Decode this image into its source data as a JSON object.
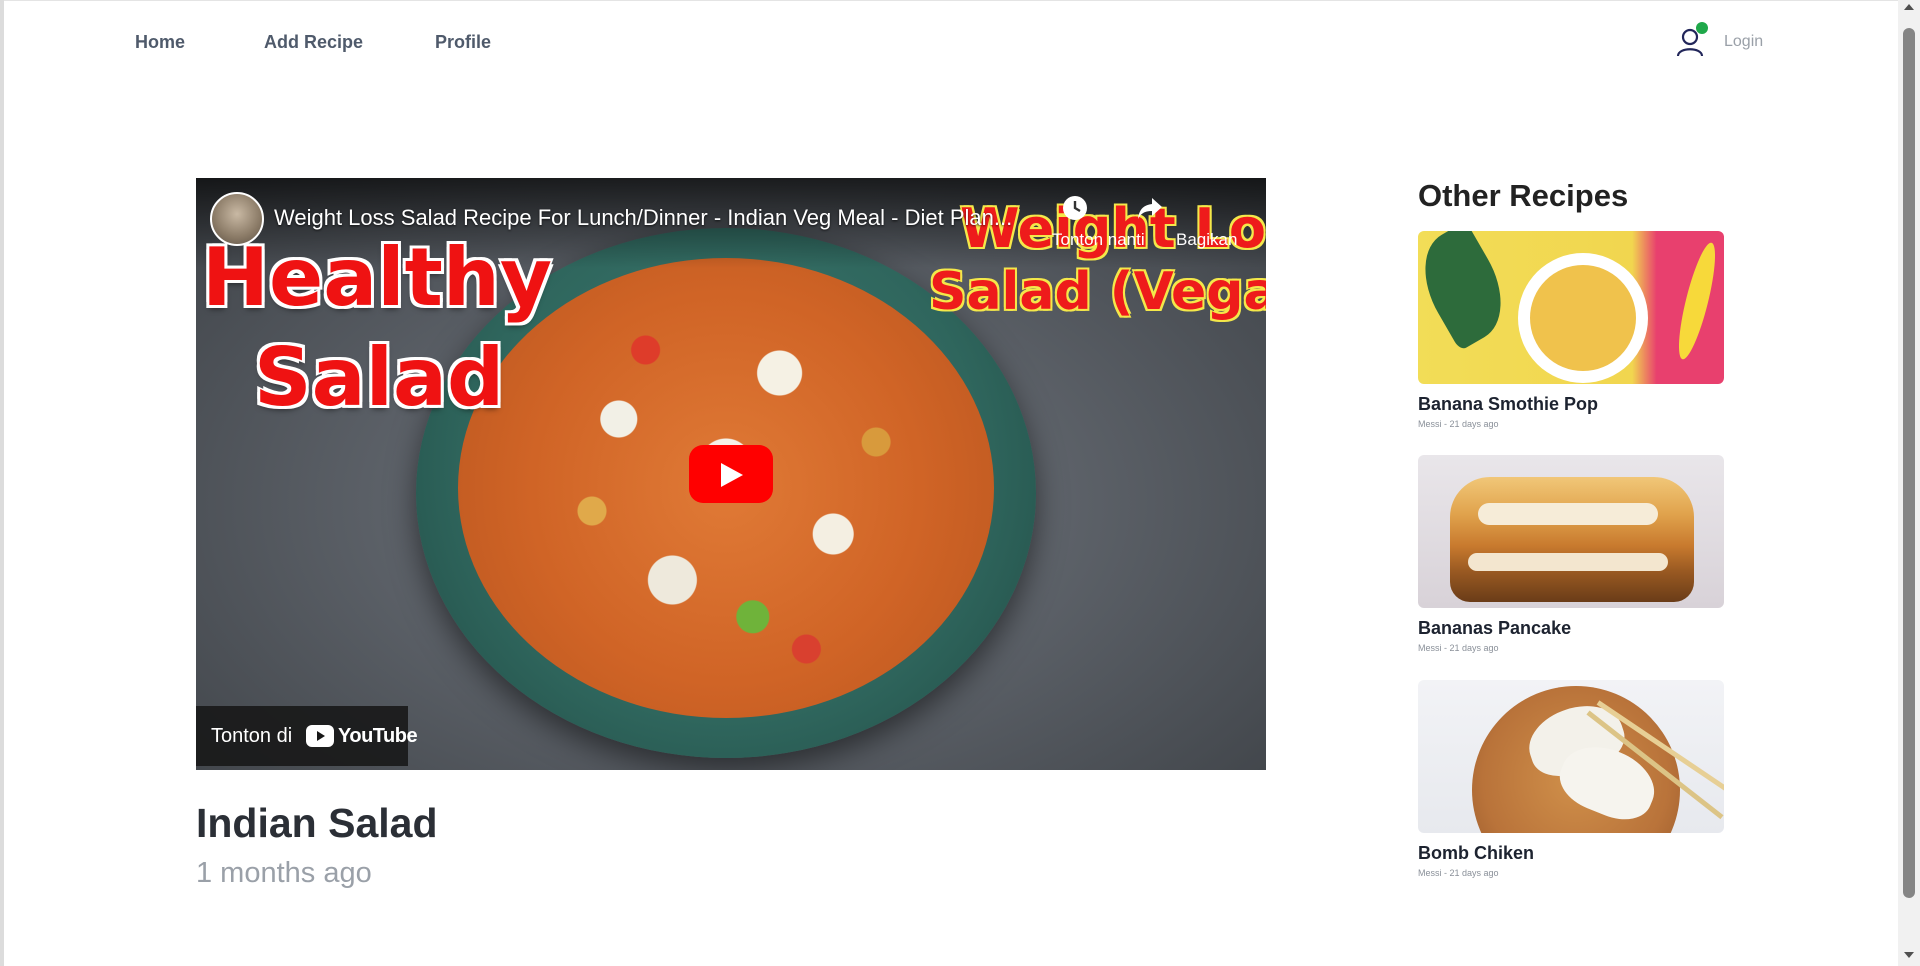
{
  "nav": {
    "items": [
      {
        "label": "Home"
      },
      {
        "label": "Add Recipe"
      },
      {
        "label": "Profile"
      }
    ],
    "login_label": "Login",
    "user_icon": "user-icon",
    "status_color": "#1fa84a"
  },
  "video": {
    "title": "Weight Loss Salad Recipe For Lunch/Dinner - Indian Veg Meal - Diet Plan...",
    "watch_later_label": "Tonton nanti",
    "share_label": "Bagikan",
    "watch_on_label": "Tonton di",
    "youtube_label": "YouTube",
    "overlay": {
      "left_line1": "Healthy",
      "left_line2": "Salad",
      "right_line1": "Weight Loss",
      "right_line2": "Salad (Vegan)"
    },
    "play_icon": "play-icon",
    "accent": "#ff0000"
  },
  "recipe": {
    "title": "Indian Salad",
    "time": "1 months ago"
  },
  "sidebar": {
    "heading": "Other Recipes",
    "cards": [
      {
        "name": "Banana Smothie Pop",
        "meta": "Messi - 21 days ago"
      },
      {
        "name": "Bananas Pancake",
        "meta": "Messi - 21 days ago"
      },
      {
        "name": "Bomb Chiken",
        "meta": "Messi - 21 days ago"
      }
    ]
  }
}
